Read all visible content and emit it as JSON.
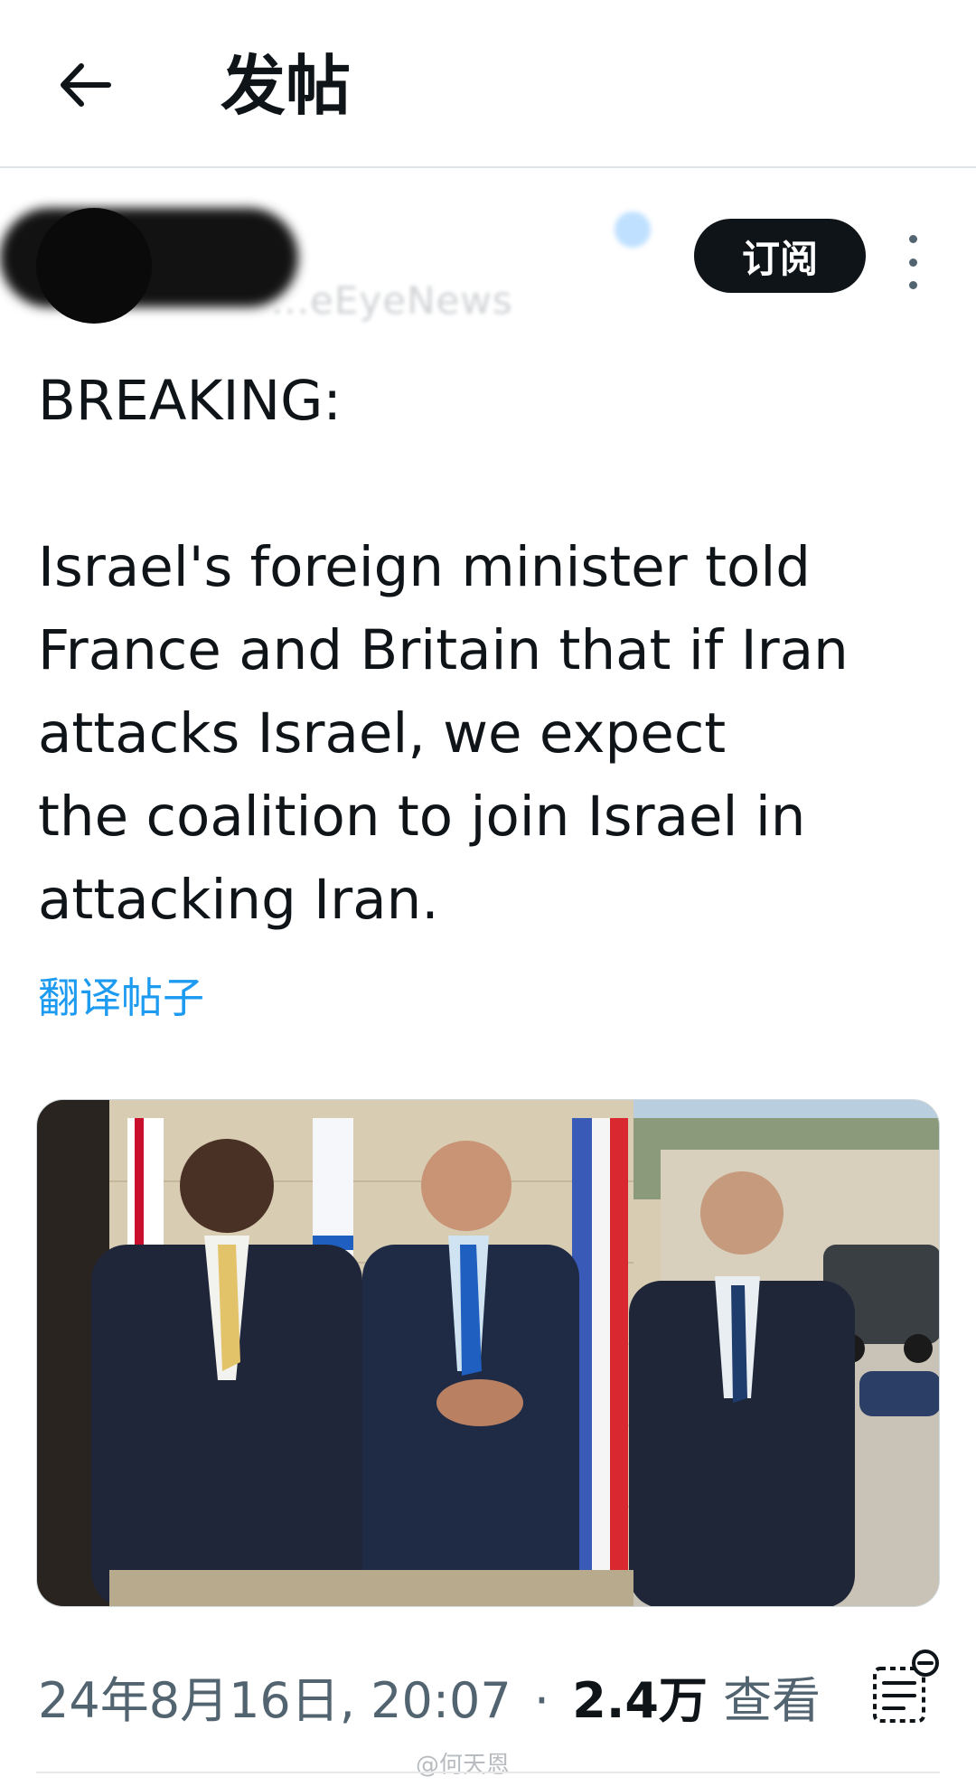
{
  "header": {
    "back_icon": "arrow-left-icon",
    "title": "发帖"
  },
  "author": {
    "handle_partial": "...eEyeNews",
    "subscribe_label": "订阅",
    "more_icon": "more-vertical-icon"
  },
  "post": {
    "text": "BREAKING:\n\nIsrael's foreign minister told\nFrance and Britain that if Iran\nattacks Israel, we expect\nthe coalition to join Israel in\nattacking Iran.",
    "translate_label": "翻译帖子"
  },
  "media": {
    "photo_icon": "photo"
  },
  "meta": {
    "date": "24年8月16日, 20:07",
    "separator": "·",
    "views_count": "2.4万",
    "views_label": "查看",
    "queue_icon": "reading-list-icon"
  },
  "watermark": "@何天恩",
  "colors": {
    "link": "#1d9bf0",
    "text": "#0f1419",
    "secondary": "#536471"
  }
}
